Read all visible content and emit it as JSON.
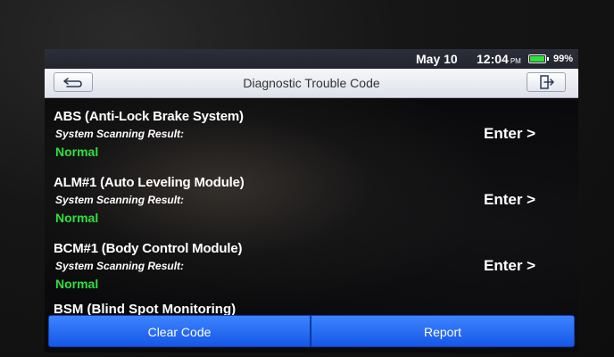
{
  "status": {
    "date": "May 10",
    "time": "12:04",
    "ampm": "PM",
    "battery": "99%",
    "battery_level": 0.99
  },
  "header": {
    "title": "Diagnostic Trouble Code",
    "back_icon": "back-arrow-icon",
    "exit_icon": "exit-icon"
  },
  "systems": [
    {
      "name": "ABS (Anti-Lock Brake System)",
      "result_label": "System Scanning Result:",
      "result": "Normal",
      "action": "Enter >"
    },
    {
      "name": "ALM#1 (Auto Leveling Module)",
      "result_label": "System Scanning Result:",
      "result": "Normal",
      "action": "Enter >"
    },
    {
      "name": "BCM#1 (Body Control Module)",
      "result_label": "System Scanning Result:",
      "result": "Normal",
      "action": "Enter >"
    }
  ],
  "partial_item": "BSM (Blind Spot Monitoring)",
  "buttons": {
    "clear": "Clear Code",
    "report": "Report"
  },
  "colors": {
    "normal": "#2fe03c",
    "button": "#1f63f0"
  }
}
